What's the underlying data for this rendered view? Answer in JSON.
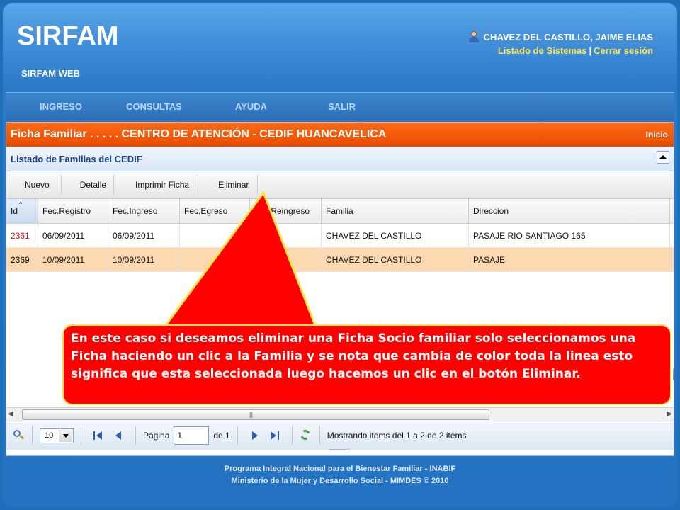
{
  "header": {
    "app_title": "SIRFAM",
    "app_subtitle": "SIRFAM WEB",
    "user_name": "CHAVEZ DEL CASTILLO, JAIME ELIAS",
    "link_systems": "Listado de Sistemas",
    "link_separator": "|",
    "link_logout": "Cerrar sesión"
  },
  "menu": {
    "items": [
      "INGRESO",
      "CONSULTAS",
      "AYUDA",
      "SALIR"
    ]
  },
  "panel": {
    "title": "Ficha Familiar . . . . . CENTRO DE ATENCIÓN - CEDIF HUANCAVELICA",
    "home_link": "Inicio",
    "subtitle": "Listado de Familias del CEDIF"
  },
  "toolbar": {
    "new_label": "Nuevo",
    "detail_label": "Detalle",
    "print_label": "Imprimir Ficha",
    "delete_label": "Eliminar"
  },
  "grid": {
    "columns": [
      "Id",
      "Fec.Registro",
      "Fec.Ingreso",
      "Fec.Egreso",
      "Fec.Reingreso",
      "Familia",
      "Direccion"
    ],
    "rows": [
      {
        "id": "2361",
        "fec_registro": "06/09/2011",
        "fec_ingreso": "06/09/2011",
        "fec_egreso": "",
        "fec_reingreso": "",
        "familia": "CHAVEZ DEL CASTILLO",
        "direccion": "PASAJE RIO SANTIAGO 165"
      },
      {
        "id": "2369",
        "fec_registro": "10/09/2011",
        "fec_ingreso": "10/09/2011",
        "fec_egreso": "",
        "fec_reingreso": "",
        "familia": "CHAVEZ DEL CASTILLO",
        "direccion": "PASAJE"
      }
    ]
  },
  "pager": {
    "page_size": "10",
    "page_label": "Página",
    "page_value": "1",
    "of_label": "de 1",
    "status": "Mostrando items del 1 a 2 de 2 items"
  },
  "callout": {
    "text": "En este caso si deseamos eliminar una Ficha Socio familiar  solo seleccionamos una Ficha haciendo un clic  a la Familia y se nota que cambia de color toda la linea esto significa que esta seleccionada luego hacemos un clic en el botón Eliminar."
  },
  "footer": {
    "line1": "Programa Integral Nacional para el Bienestar Familiar - INABIF",
    "line2": "Ministerio de la Mujer y Desarrollo Social - MIMDES © 2010"
  },
  "colors": {
    "title_bar": "#e84c00",
    "selected_row": "#fcd9b0",
    "callout_fill": "#fe0000",
    "callout_border": "#ffe640",
    "link_yellow": "#ffe54a"
  }
}
